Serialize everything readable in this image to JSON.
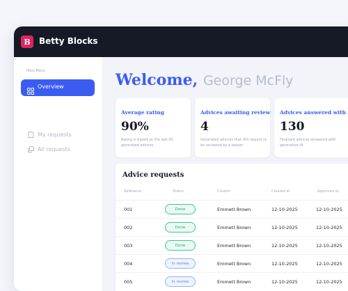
{
  "app": {
    "logo_letter": "B",
    "name": "Betty Blocks"
  },
  "sidebar": {
    "caption": "Main Menu",
    "items": [
      {
        "label": "Overview",
        "icon": "grid-icon",
        "active": true
      },
      {
        "label": "My requests",
        "icon": "document-icon",
        "active": false
      },
      {
        "label": "All requests",
        "icon": "documents-icon",
        "active": false
      }
    ]
  },
  "header": {
    "greeting": "Welcome,",
    "user_name": "George McFly"
  },
  "cards": [
    {
      "title": "Average rating",
      "value": "90%",
      "description": "Rating is based on the last 50 generated advices"
    },
    {
      "title": "Advices awaiting review",
      "value": "4",
      "description": "Generated advices that still require to be reviewed by a lawyer"
    },
    {
      "title": "Advices answered with AI",
      "value": "130",
      "description": "Finalized advices answered with generative AI"
    }
  ],
  "table": {
    "title": "Advice requests",
    "columns": [
      "Reference",
      "Status",
      "Creator",
      "Created at",
      "Approved at"
    ],
    "rows": [
      {
        "reference": "001",
        "status": "Done",
        "creator": "Emmett Brown",
        "created_at": "12-10-2025",
        "approved_at": "12-10-2025"
      },
      {
        "reference": "002",
        "status": "Done",
        "creator": "Emmett Brown",
        "created_at": "12-10-2025",
        "approved_at": "12-10-2025"
      },
      {
        "reference": "003",
        "status": "Done",
        "creator": "Emmett Brown",
        "created_at": "12-10-2025",
        "approved_at": "12-10-2025"
      },
      {
        "reference": "004",
        "status": "In review",
        "creator": "Emmett Brown",
        "created_at": "12-10-2025",
        "approved_at": "12-10-2025"
      },
      {
        "reference": "005",
        "status": "In review",
        "creator": "Emmett Brown",
        "created_at": "12-10-2025",
        "approved_at": "12-10-2025"
      }
    ]
  },
  "colors": {
    "accent": "#3b5cf3",
    "brand": "#e0245e",
    "topbar": "#151a26",
    "done": "#25a874",
    "review": "#5a88e6"
  }
}
